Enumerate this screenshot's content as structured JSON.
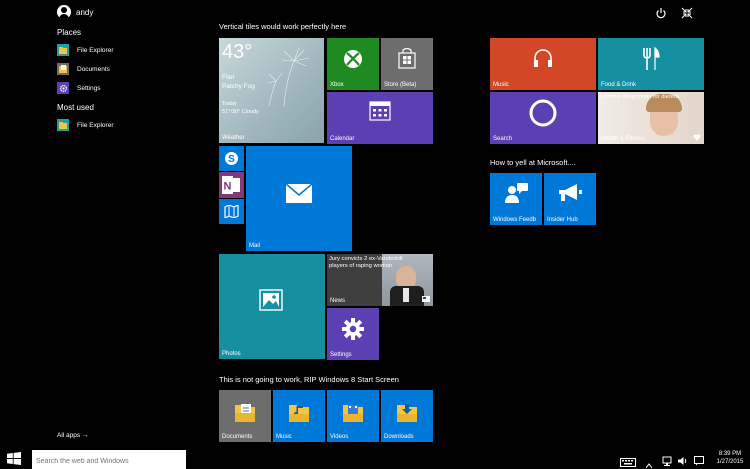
{
  "user": {
    "name": "andy"
  },
  "left": {
    "places_title": "Places",
    "places": [
      {
        "label": "File Explorer"
      },
      {
        "label": "Documents"
      },
      {
        "label": "Settings"
      }
    ],
    "most_used_title": "Most used",
    "most_used": [
      {
        "label": "File Explorer"
      }
    ],
    "all_apps": "All apps →"
  },
  "groups": {
    "g1_title": "Vertical tiles would work perfectly here",
    "g2_title": "How to yell at Microsoft....",
    "g3_title": "This is not going to work, RIP Windows 8 Start Screen"
  },
  "weather": {
    "temp": "43°",
    "place": "Filer",
    "condition": "Patchy Fog",
    "today": "Today",
    "range": "51°/30° Cloudy",
    "label": "Weather"
  },
  "tiles": {
    "xbox": "Xbox",
    "store": "Store (Beta)",
    "calendar": "Calendar",
    "mail": "Mail",
    "photos": "Photos",
    "news": "News",
    "news_headline": "Jury convicts 2 ex-Vanderbilt players of raping woman",
    "settings": "Settings",
    "music": "Music",
    "food": "Food & Drink",
    "search": "Search",
    "health": "Health & Fitness",
    "health_headline": "10 most filling foods for dieters",
    "feedback": "Windows Feedb",
    "insider": "Insider Hub",
    "documents": "Documents",
    "music2": "Music",
    "videos": "Videos",
    "downloads": "Downloads"
  },
  "taskbar": {
    "search_placeholder": "Search the web and Windows",
    "time": "8:39 PM",
    "date": "1/27/2015"
  },
  "colors": {
    "green": "#1f8a1f",
    "purple": "#5b3fb3",
    "blue": "#0078d7",
    "teal": "#168fa1",
    "orange": "#d24726",
    "gray": "#6d6d6d"
  }
}
